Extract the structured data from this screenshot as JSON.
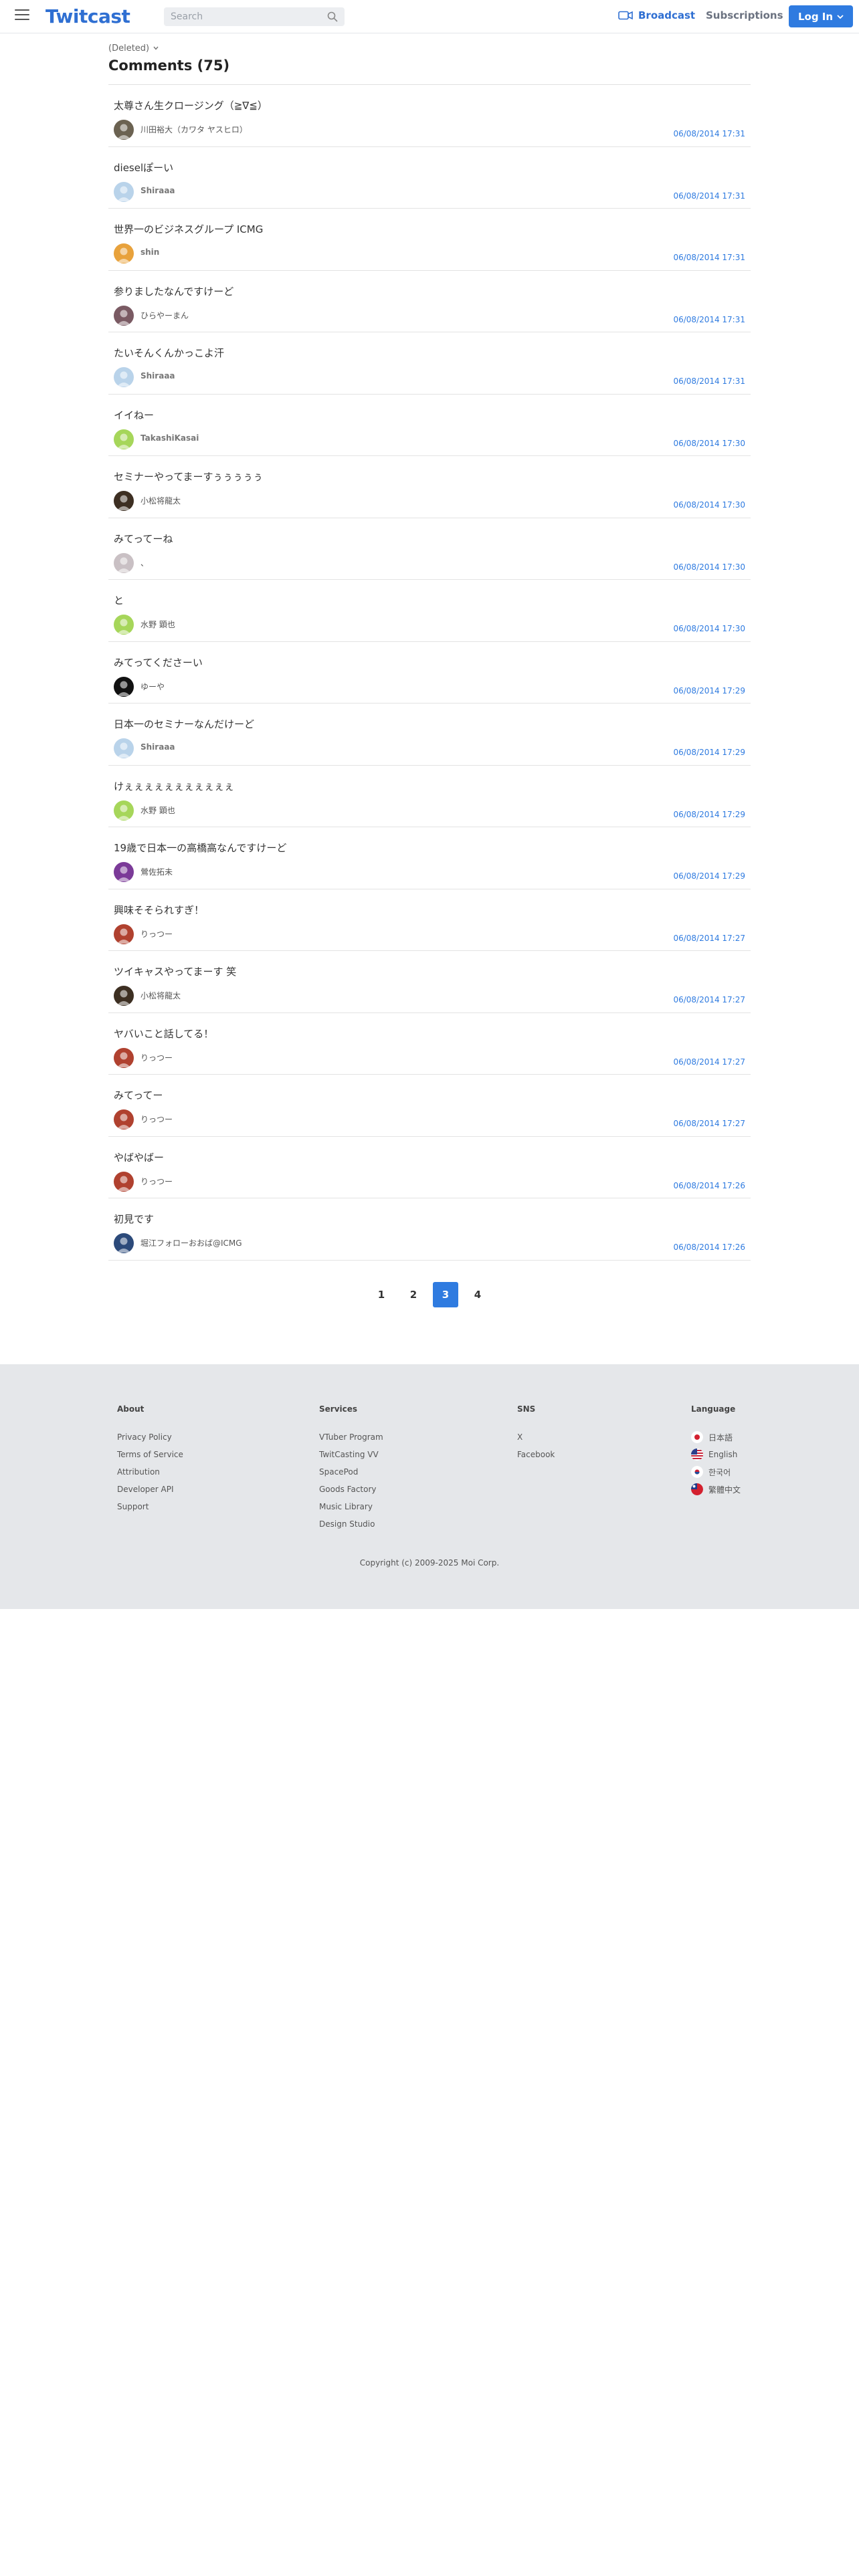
{
  "header": {
    "logo": "Twitcast",
    "search_placeholder": "Search",
    "broadcast_label": "Broadcast",
    "subscriptions_label": "Subscriptions",
    "login_label": "Log In",
    "accent_color": "#2f7be0"
  },
  "page": {
    "user_label": "(Deleted)",
    "title": "Comments (75)"
  },
  "comments": [
    {
      "text": "太尊さん生クロージング（≧∇≦）",
      "user": "川田裕大（カワタ ヤスヒロ）",
      "time": "06/08/2014 17:31",
      "avatar_color": "#6b6251",
      "bold": false
    },
    {
      "text": "dieselぽーい",
      "user": "Shiraaa",
      "time": "06/08/2014 17:31",
      "avatar_color": "#b9d3ea",
      "bold": true
    },
    {
      "text": "世界一のビジネスグループ ICMG",
      "user": "shin",
      "time": "06/08/2014 17:31",
      "avatar_color": "#e8a23c",
      "bold": true
    },
    {
      "text": "参りましたなんですけーど",
      "user": "ひらやーまん",
      "time": "06/08/2014 17:31",
      "avatar_color": "#7a5a63",
      "bold": false
    },
    {
      "text": "たいそんくんかっこよ汗",
      "user": "Shiraaa",
      "time": "06/08/2014 17:31",
      "avatar_color": "#b9d3ea",
      "bold": true
    },
    {
      "text": "イイねー",
      "user": "TakashiKasai",
      "time": "06/08/2014 17:30",
      "avatar_color": "#a6d65a",
      "bold": true
    },
    {
      "text": "セミナーやってまーすぅぅぅぅぅ",
      "user": "小松将龍太",
      "time": "06/08/2014 17:30",
      "avatar_color": "#3d2f22",
      "bold": false
    },
    {
      "text": "みてってーね",
      "user": "、",
      "time": "06/08/2014 17:30",
      "avatar_color": "#c9c0c4",
      "bold": false
    },
    {
      "text": "と",
      "user": "水野 顕也",
      "time": "06/08/2014 17:30",
      "avatar_color": "#a6d65a",
      "bold": false
    },
    {
      "text": "みてってくださーい",
      "user": "ゆーや",
      "time": "06/08/2014 17:29",
      "avatar_color": "#111111",
      "bold": false
    },
    {
      "text": "日本一のセミナーなんだけーど",
      "user": "Shiraaa",
      "time": "06/08/2014 17:29",
      "avatar_color": "#b9d3ea",
      "bold": true
    },
    {
      "text": "けぇぇぇぇぇぇぇぇぇぇぇ",
      "user": "水野 顕也",
      "time": "06/08/2014 17:29",
      "avatar_color": "#a6d65a",
      "bold": false
    },
    {
      "text": "19歳で日本一の高橋高なんですけーど",
      "user": "鶯佐拓未",
      "time": "06/08/2014 17:29",
      "avatar_color": "#7b3a98",
      "bold": false
    },
    {
      "text": "興味そそられすぎ！",
      "user": "りっつー",
      "time": "06/08/2014 17:27",
      "avatar_color": "#b0412f",
      "bold": false
    },
    {
      "text": "ツイキャスやってまーす 笑",
      "user": "小松将龍太",
      "time": "06/08/2014 17:27",
      "avatar_color": "#3d2f22",
      "bold": false
    },
    {
      "text": "ヤバいこと話してる！",
      "user": "りっつー",
      "time": "06/08/2014 17:27",
      "avatar_color": "#b0412f",
      "bold": false
    },
    {
      "text": "みてってー",
      "user": "りっつー",
      "time": "06/08/2014 17:27",
      "avatar_color": "#b0412f",
      "bold": false
    },
    {
      "text": "やばやばー",
      "user": "りっつー",
      "time": "06/08/2014 17:26",
      "avatar_color": "#b0412f",
      "bold": false
    },
    {
      "text": "初見です",
      "user": "堀江フォローおおば@ICMG",
      "time": "06/08/2014 17:26",
      "avatar_color": "#2c4a7a",
      "bold": false
    }
  ],
  "pagination": {
    "pages": [
      "1",
      "2",
      "3",
      "4"
    ],
    "current": "3"
  },
  "footer": {
    "about": {
      "title": "About",
      "links": [
        "Privacy Policy",
        "Terms of Service",
        "Attribution",
        "Developer API",
        "Support"
      ]
    },
    "services": {
      "title": "Services",
      "links": [
        "VTuber Program",
        "TwitCasting VV",
        "SpacePod",
        "Goods Factory",
        "Music Library",
        "Design Studio"
      ]
    },
    "sns": {
      "title": "SNS",
      "links": [
        "X",
        "Facebook"
      ]
    },
    "language": {
      "title": "Language",
      "links": [
        "日本語",
        "English",
        "한국어",
        "繁體中文"
      ]
    },
    "copyright": "Copyright (c) 2009-2025 Moi Corp."
  }
}
